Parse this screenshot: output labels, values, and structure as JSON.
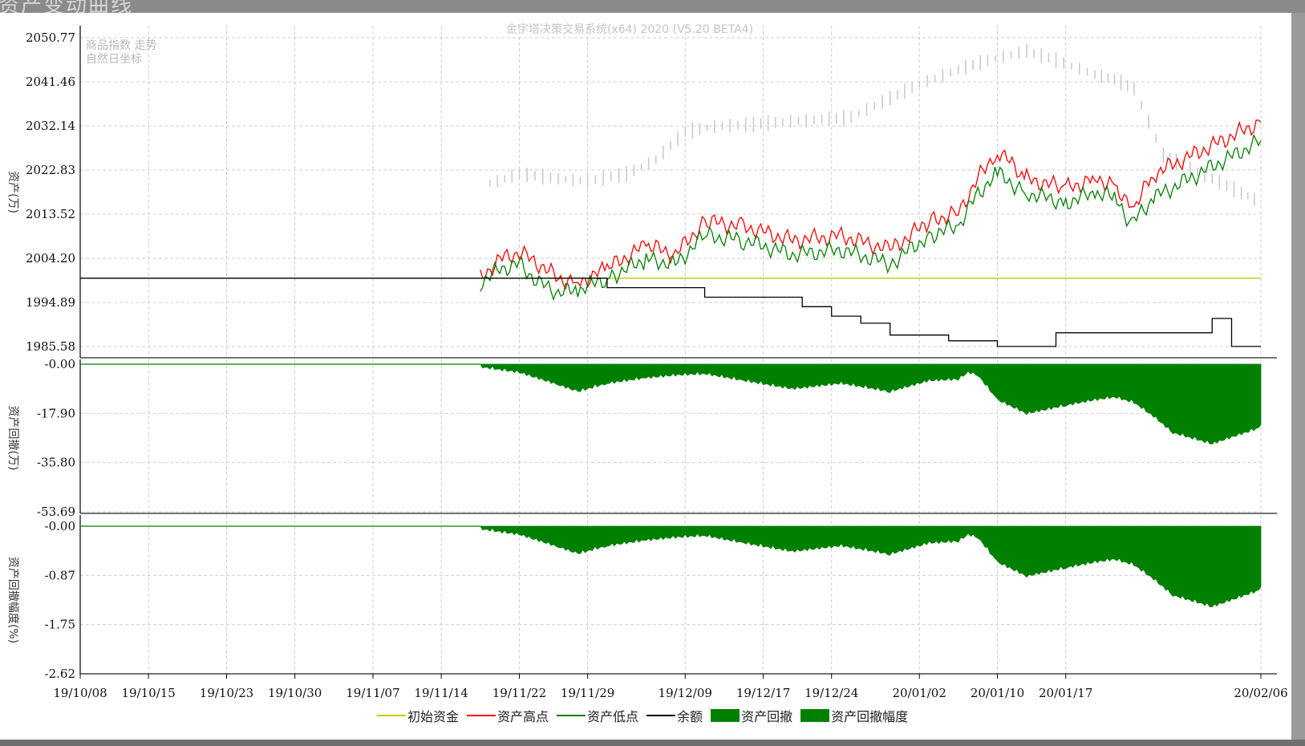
{
  "window": {
    "title_fragment": "资产变动曲线",
    "watermark": "金字塔决策交易系统(x64) 2020 (V5.20 BETA4)"
  },
  "chart_data": [
    {
      "type": "line",
      "panel": "asset",
      "overlay_text": [
        "商品指数 走势",
        "自然日坐标"
      ],
      "ylabel": "资产(万)",
      "ylim": [
        1985.58,
        2050.77
      ],
      "yticks": [
        "2050.77",
        "2041.46",
        "2032.14",
        "2022.83",
        "2013.52",
        "2004.20",
        "1994.89",
        "1985.58"
      ],
      "x_start": "19/10/08",
      "x_end": "20/02/06",
      "grid": true,
      "series": [
        {
          "name": "初始资金",
          "color": "#c8c800",
          "x": [
            "19/10/08",
            "20/02/06"
          ],
          "values": [
            2000.0,
            2000.0
          ]
        },
        {
          "name": "资产高点",
          "color": "#ff0000",
          "x": [
            "19/11/18",
            "19/11/20",
            "19/11/22",
            "19/11/24",
            "19/11/26",
            "19/11/28",
            "19/12/01",
            "19/12/05",
            "19/12/08",
            "19/12/11",
            "19/12/15",
            "19/12/20",
            "19/12/25",
            "19/12/30",
            "20/01/03",
            "20/01/06",
            "20/01/08",
            "20/01/10",
            "20/01/13",
            "20/01/17",
            "20/01/20",
            "20/01/22",
            "20/01/23",
            "20/01/24",
            "20/01/26",
            "20/02/06"
          ],
          "values": [
            2000.0,
            2004.0,
            2005.5,
            2003.0,
            2000.0,
            1999.0,
            2002.0,
            2007.0,
            2005.0,
            2012.0,
            2011.0,
            2008.0,
            2009.0,
            2006.0,
            2012.0,
            2014.0,
            2021.0,
            2027.0,
            2021.0,
            2019.0,
            2021.0,
            2020.0,
            2016.0,
            2015.0,
            2022.0,
            2033.0
          ]
        },
        {
          "name": "资产低点",
          "color": "#008000",
          "x": [
            "19/11/18",
            "19/11/20",
            "19/11/22",
            "19/11/24",
            "19/11/26",
            "19/11/28",
            "19/12/01",
            "19/12/05",
            "19/12/08",
            "19/12/11",
            "19/12/15",
            "19/12/20",
            "19/12/25",
            "19/12/30",
            "20/01/03",
            "20/01/06",
            "20/01/08",
            "20/01/10",
            "20/01/13",
            "20/01/17",
            "20/01/20",
            "20/01/22",
            "20/01/23",
            "20/01/24",
            "20/01/26",
            "20/02/06"
          ],
          "values": [
            1999.0,
            2002.0,
            2003.0,
            1999.0,
            1997.0,
            1997.5,
            2000.0,
            2004.0,
            2003.0,
            2009.0,
            2008.0,
            2005.0,
            2006.0,
            2003.0,
            2009.0,
            2011.0,
            2018.0,
            2022.0,
            2018.0,
            2016.0,
            2018.0,
            2017.0,
            2013.0,
            2012.0,
            2017.0,
            2029.0
          ]
        },
        {
          "name": "余额",
          "color": "#000000",
          "x": [
            "19/10/08",
            "19/12/01",
            "19/12/01",
            "19/12/11",
            "19/12/11",
            "19/12/21",
            "19/12/21",
            "19/12/24",
            "19/12/24",
            "19/12/27",
            "19/12/27",
            "19/12/30",
            "19/12/30",
            "20/01/05",
            "20/01/05",
            "20/01/10",
            "20/01/10",
            "20/01/16",
            "20/01/16",
            "20/02/01",
            "20/02/01",
            "20/02/03",
            "20/02/03",
            "20/02/06"
          ],
          "values": [
            2000.0,
            2000.0,
            1998.0,
            1998.0,
            1996.0,
            1996.0,
            1994.0,
            1994.0,
            1992.0,
            1992.0,
            1990.5,
            1990.5,
            1988.0,
            1988.0,
            1986.8,
            1986.8,
            1985.6,
            1985.6,
            1988.5,
            1988.5,
            1991.5,
            1991.5,
            1985.6,
            1985.6
          ]
        }
      ],
      "background_series": {
        "name": "商品指数",
        "color": "#c8c8c8",
        "x": [
          "19/11/19",
          "19/11/22",
          "19/11/26",
          "19/11/29",
          "19/12/03",
          "19/12/06",
          "19/12/09",
          "19/12/12",
          "19/12/16",
          "19/12/19",
          "19/12/23",
          "19/12/26",
          "19/12/30",
          "20/01/02",
          "20/01/06",
          "20/01/09",
          "20/01/13",
          "20/01/16",
          "20/01/20",
          "20/01/22",
          "20/01/24",
          "20/01/27",
          "20/01/29",
          "20/02/01",
          "20/02/04",
          "20/02/06"
        ],
        "values": [
          2020.0,
          2022.0,
          2021.0,
          2020.5,
          2022.0,
          2025.0,
          2031.0,
          2032.0,
          2032.5,
          2033.0,
          2033.5,
          2034.0,
          2038.0,
          2041.0,
          2044.0,
          2046.0,
          2048.0,
          2046.0,
          2043.0,
          2042.0,
          2040.0,
          2026.0,
          2024.0,
          2021.0,
          2018.0,
          2016.0
        ]
      }
    },
    {
      "type": "area",
      "panel": "drawdown",
      "ylabel": "资产回撤(万)",
      "ylim": [
        -53.69,
        0
      ],
      "yticks": [
        "-0.00",
        "-17.90",
        "-35.80",
        "-53.69"
      ],
      "grid": true,
      "series": [
        {
          "name": "资产回撤",
          "color": "#008000",
          "x": [
            "19/11/18",
            "19/11/22",
            "19/11/26",
            "19/11/28",
            "19/12/01",
            "19/12/05",
            "19/12/08",
            "19/12/11",
            "19/12/15",
            "19/12/20",
            "19/12/25",
            "19/12/30",
            "20/01/03",
            "20/01/06",
            "20/01/07",
            "20/01/08",
            "20/01/10",
            "20/01/13",
            "20/01/17",
            "20/01/20",
            "20/01/22",
            "20/01/24",
            "20/01/26",
            "20/01/28",
            "20/02/01",
            "20/02/06"
          ],
          "values": [
            0,
            -2.0,
            -6.5,
            -9.0,
            -6.0,
            -4.0,
            -3.0,
            -2.5,
            -5.0,
            -8.0,
            -6.0,
            -9.0,
            -5.0,
            -4.5,
            -2.0,
            -3.0,
            -12.0,
            -17.0,
            -14.0,
            -12.0,
            -11.0,
            -13.0,
            -18.0,
            -24.0,
            -28.0,
            -22.0
          ]
        }
      ]
    },
    {
      "type": "area",
      "panel": "drawdown_pct",
      "ylabel": "资产回撤幅度(%)",
      "ylim": [
        -2.62,
        0
      ],
      "yticks": [
        "-0.00",
        "-0.87",
        "-1.75",
        "-2.62"
      ],
      "grid": true,
      "series": [
        {
          "name": "资产回撤幅度",
          "color": "#008000",
          "x": [
            "19/11/18",
            "19/11/22",
            "19/11/26",
            "19/11/28",
            "19/12/01",
            "19/12/05",
            "19/12/08",
            "19/12/11",
            "19/12/15",
            "19/12/20",
            "19/12/25",
            "19/12/30",
            "20/01/03",
            "20/01/06",
            "20/01/07",
            "20/01/08",
            "20/01/10",
            "20/01/13",
            "20/01/17",
            "20/01/20",
            "20/01/22",
            "20/01/24",
            "20/01/26",
            "20/01/28",
            "20/02/01",
            "20/02/06"
          ],
          "values": [
            0,
            -0.1,
            -0.32,
            -0.44,
            -0.3,
            -0.2,
            -0.15,
            -0.12,
            -0.25,
            -0.4,
            -0.3,
            -0.45,
            -0.25,
            -0.22,
            -0.1,
            -0.15,
            -0.59,
            -0.84,
            -0.69,
            -0.59,
            -0.54,
            -0.64,
            -0.89,
            -1.18,
            -1.38,
            -1.08
          ]
        }
      ]
    }
  ],
  "xticks": [
    "19/10/08",
    "19/10/15",
    "19/10/23",
    "19/10/30",
    "19/11/07",
    "19/11/14",
    "19/11/22",
    "19/11/29",
    "19/12/09",
    "19/12/17",
    "19/12/24",
    "20/01/02",
    "20/01/10",
    "20/01/17",
    "20/02/06"
  ],
  "legend": [
    {
      "label": "初始资金",
      "color": "#c8c800",
      "kind": "line"
    },
    {
      "label": "资产高点",
      "color": "#ff0000",
      "kind": "line"
    },
    {
      "label": "资产低点",
      "color": "#008000",
      "kind": "line"
    },
    {
      "label": "余额",
      "color": "#000000",
      "kind": "line"
    },
    {
      "label": "资产回撤",
      "color": "#008000",
      "kind": "box"
    },
    {
      "label": "资产回撤幅度",
      "color": "#008000",
      "kind": "box"
    }
  ]
}
